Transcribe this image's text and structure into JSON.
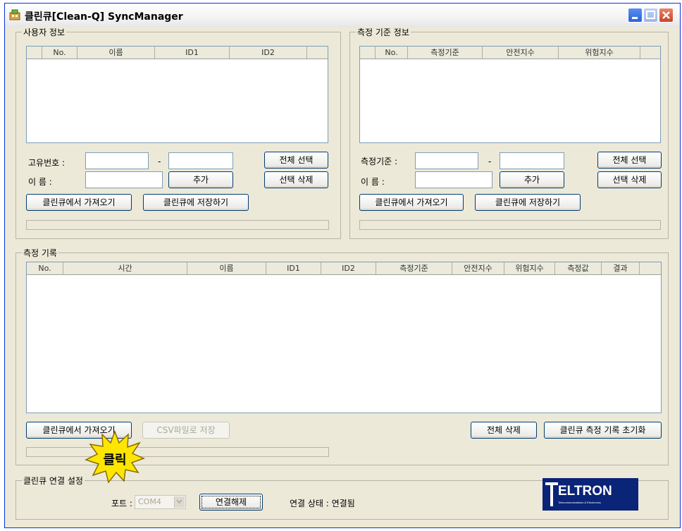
{
  "window": {
    "title": "클린큐[Clean-Q] SyncManager"
  },
  "user_info": {
    "group_label": "사용자 정보",
    "columns": [
      "No.",
      "이름",
      "ID1",
      "ID2"
    ],
    "serial_label": "고유번호 :",
    "dash": "-",
    "name_label": "이  름 :",
    "select_all": "전체 선택",
    "add": "추가",
    "delete_selected": "선택 삭제",
    "fetch": "클린큐에서 가져오기",
    "save": "클린큐에 저장하기"
  },
  "criteria_info": {
    "group_label": "측정 기준 정보",
    "columns": [
      "No.",
      "측정기준",
      "안전지수",
      "위험지수"
    ],
    "criteria_label": "측정기준 :",
    "dash": "-",
    "name_label": "이  름 :",
    "select_all": "전체 선택",
    "add": "추가",
    "delete_selected": "선택 삭제",
    "fetch": "클린큐에서 가져오기",
    "save": "클린큐에 저장하기"
  },
  "records": {
    "group_label": "측정 기록",
    "columns": [
      "No.",
      "시간",
      "이름",
      "ID1",
      "ID2",
      "측정기준",
      "안전지수",
      "위험지수",
      "측정값",
      "결과"
    ],
    "fetch": "클린큐에서 가져오기",
    "csv_save": "CSV파일로 저장",
    "delete_all": "전체 삭제",
    "reset": "클린큐 측정 기록 초기화"
  },
  "connection": {
    "group_label": "클린큐 연결 설정",
    "port_label": "포트 :",
    "port_value": "COM4",
    "disconnect": "연결해제",
    "status": "연결 상태 : 연결됨"
  },
  "callout": {
    "text": "클릭",
    "color": "#ffe600"
  },
  "logo": {
    "text": "ELTRON",
    "letter": "T",
    "subtext": "Telecommunications & Electronics"
  }
}
